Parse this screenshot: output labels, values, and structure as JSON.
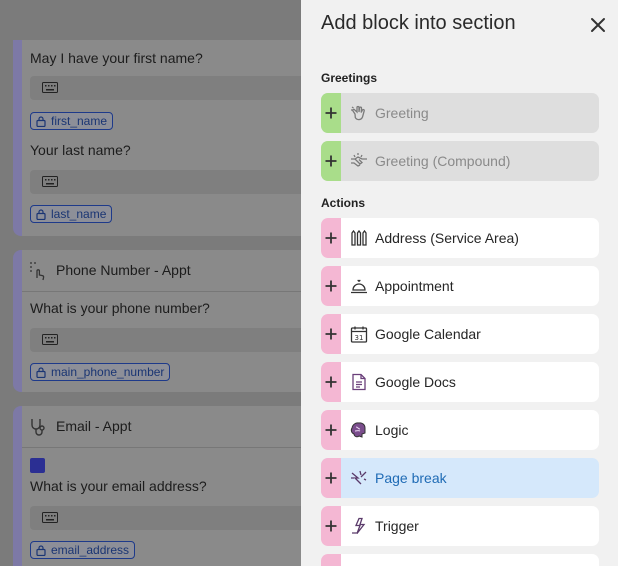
{
  "background": {
    "card1": {
      "question1": "May I have your first name?",
      "variable1": "first_name",
      "question2": "Your last name?",
      "variable2": "last_name"
    },
    "card2": {
      "title": "Phone Number - Appt",
      "question": "What is your phone number?",
      "variable": "main_phone_number"
    },
    "card3": {
      "title": "Email - Appt",
      "question": "What is your email address?",
      "variable": "email_address"
    }
  },
  "drawer": {
    "title": "Add block into section",
    "close_icon": "close-icon",
    "sections": [
      {
        "label": "Greetings",
        "items": [
          {
            "label": "Greeting",
            "icon": "wave-hand-icon",
            "state": "disabled"
          },
          {
            "label": "Greeting (Compound)",
            "icon": "handshake-icon",
            "state": "disabled"
          }
        ]
      },
      {
        "label": "Actions",
        "items": [
          {
            "label": "Address (Service Area)",
            "icon": "fence-icon",
            "state": "normal"
          },
          {
            "label": "Appointment",
            "icon": "service-bell-icon",
            "state": "normal"
          },
          {
            "label": "Google Calendar",
            "icon": "calendar-icon",
            "state": "normal"
          },
          {
            "label": "Google Docs",
            "icon": "document-icon",
            "state": "normal"
          },
          {
            "label": "Logic",
            "icon": "brain-icon",
            "state": "normal"
          },
          {
            "label": "Page break",
            "icon": "page-break-icon",
            "state": "active"
          },
          {
            "label": "Trigger",
            "icon": "trigger-icon",
            "state": "normal"
          }
        ]
      }
    ]
  },
  "colors": {
    "plus_normal": "#f4b7d3",
    "plus_disabled": "#a9dd8a",
    "active_bg": "#d5e8fb",
    "active_text": "#1f6bb5",
    "card_accent": "#7d79a6"
  }
}
